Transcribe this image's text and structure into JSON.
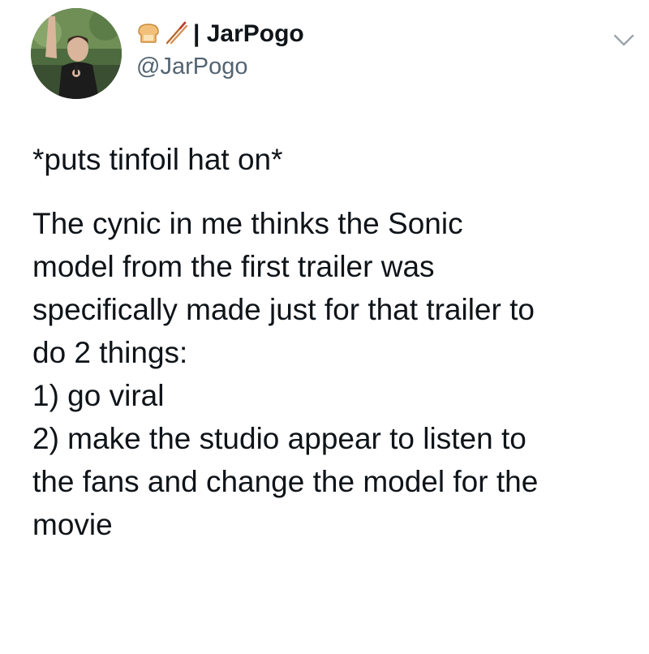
{
  "author": {
    "display_emojis": [
      "bread-icon",
      "chopsticks-icon"
    ],
    "display_name": "| JarPogo",
    "handle": "@JarPogo"
  },
  "menu": {
    "icon": "chevron-down-icon"
  },
  "tweet": {
    "intro": "*puts tinfoil hat on*",
    "lines": [
      "The cynic in me thinks the Sonic",
      "model from the first trailer was",
      "specifically made just for that trailer to",
      "do 2 things:",
      "1) go viral",
      "2) make the studio appear to listen to",
      "the fans and change the model for the",
      "movie"
    ]
  },
  "colors": {
    "text": "#0f1419",
    "secondary_text": "#536471",
    "background": "#ffffff"
  }
}
